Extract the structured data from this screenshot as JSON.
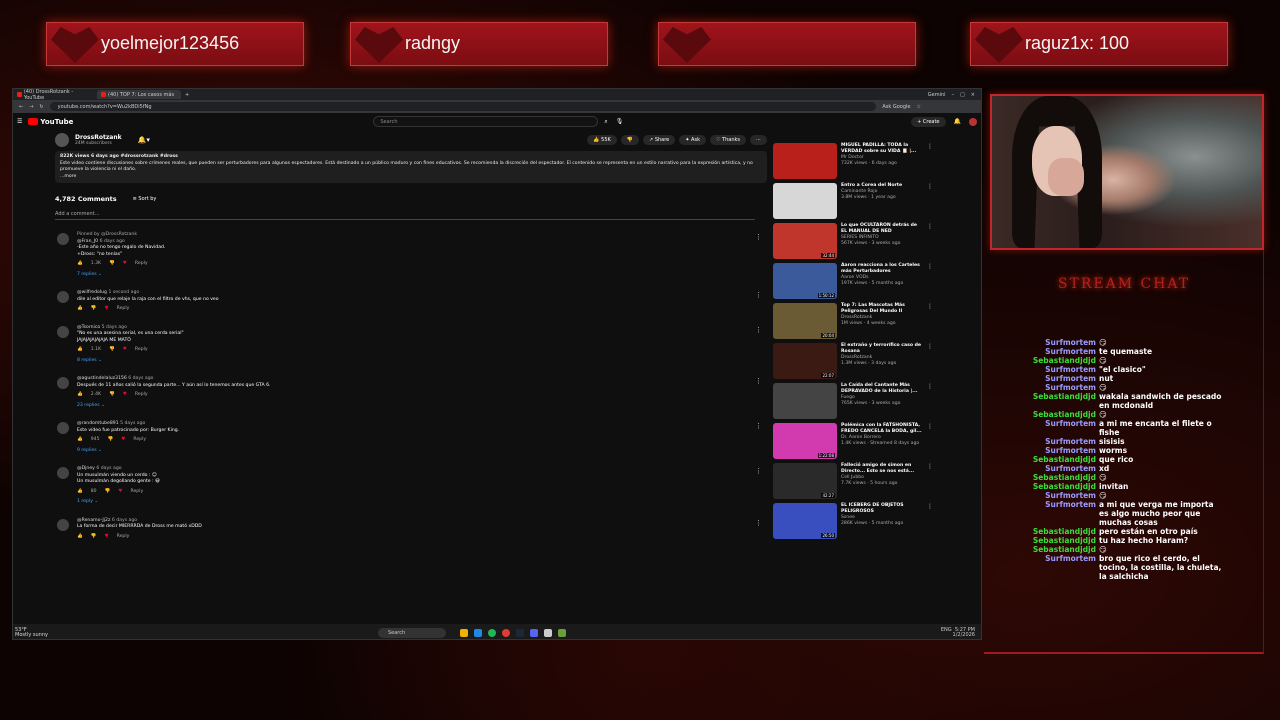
{
  "banners": [
    "yoelmejor123456",
    "radngy",
    "",
    "raguz1x: 100"
  ],
  "browser": {
    "tabs": [
      {
        "label": "(40) DrossRotzank - YouTube"
      },
      {
        "label": "(40) TOP 7: Los casos más"
      }
    ],
    "window_buttons": [
      "Gemini",
      "–",
      "□",
      "×"
    ],
    "url": "youtube.com/watch?v=Wu2kBDi5fNg",
    "ask_google": "Ask Google"
  },
  "youtube": {
    "logo": "YouTube",
    "search_placeholder": "Search",
    "create_label": "+ Create",
    "channel": {
      "name": "DrossRotzank",
      "subs": "24M subscribers"
    },
    "actions": [
      "👍 55K",
      "👎",
      "↗ Share",
      "✦ Ask",
      "♡ Thanks",
      "⋯"
    ],
    "description": {
      "meta": "822K views  6 days ago  #drossrotzank #dross",
      "text": "Este video contiene discusiones sobre crímenes reales, que pueden ser perturbadores para algunos espectadores. Está destinado a un público maduro y con fines educativos.  Se recomienda la discreción del espectador. El contenido se representa en un estilo narrativo para la expresión artística, y no promueve la violencia ni el daño.",
      "more": "...more"
    },
    "comments_count": "4,782 Comments",
    "sort_label": "Sort by",
    "add_comment": "Add a comment...",
    "comments": [
      {
        "pinned": "Pinned by @DrossRotzank",
        "author": "@Fran_J0",
        "time": "6 days ago",
        "lines": [
          "-Este año no tengo regalo de Navidad.",
          "+Dross: \"no tenías\""
        ],
        "likes": "1.3K",
        "replies": "7 replies"
      },
      {
        "pinned": "",
        "author": "@wilfredolug",
        "time": "1 second ago",
        "lines": [
          "dile al editor que relaje la raja con el filtro de vhs, que no veo"
        ],
        "likes": "",
        "replies": ""
      },
      {
        "pinned": "",
        "author": "@Tsornico",
        "time": "5 days ago",
        "lines": [
          "\"No es una asesina serial, es una cerda serial\"",
          "JAJAJAJAJAJAJA ME MATÓ"
        ],
        "likes": "1.1K",
        "replies": "8 replies"
      },
      {
        "pinned": "",
        "author": "@agustindelaluz3156",
        "time": "6 days ago",
        "lines": [
          "Después de 11 años salió la segunda parte... Y aún así lo tenemos antes que GTA 6."
        ],
        "likes": "2.4K",
        "replies": "23 replies"
      },
      {
        "pinned": "",
        "author": "@randomtube891",
        "time": "5 days ago",
        "lines": [
          "Este vídeo fue patrocinado por: Burger King."
        ],
        "likes": "945",
        "replies": "9 replies"
      },
      {
        "pinned": "",
        "author": "@Djney",
        "time": "6 days ago",
        "lines": [
          "Un musulmán viendo un cerdo : 😐",
          "Un musulmán degollando gente : 😀"
        ],
        "likes": "80",
        "replies": "1 reply"
      },
      {
        "pinned": "",
        "author": "@Renamo-Jj2z",
        "time": "6 days ago",
        "lines": [
          "La forma de decir MIERRRDA de Dross me mató xDDD"
        ],
        "likes": "",
        "replies": ""
      }
    ],
    "recommendations": [
      {
        "title": "MIGUEL PADILLA: TODA la VERDAD sobre su VIDA 📋 |...",
        "channel": "Mr Doctor",
        "meta": "732K views · 6 days ago",
        "dur": "",
        "color": "#b9201c"
      },
      {
        "title": "Entro a Corea del Norte",
        "channel": "Caminante Rojo",
        "meta": "3.8M views · 1 year ago",
        "dur": "",
        "color": "#d7d7d7"
      },
      {
        "title": "Lo que OCULTARON detrás de EL MANUAL DE NED",
        "channel": "SERIES INFINITO",
        "meta": "567K views · 3 weeks ago",
        "dur": "32:44",
        "color": "#c0352c"
      },
      {
        "title": "Aaron reacciona a los Carteles más Perturbadores",
        "channel": "Aaron VODs",
        "meta": "197K views · 5 months ago",
        "dur": "1:50:12",
        "color": "#3b5a9c"
      },
      {
        "title": "Top 7: Las Mascotas Más Peligrosas Del Mundo II",
        "channel": "DrossRotzank",
        "meta": "1M views · 4 weeks ago",
        "dur": "20:04",
        "color": "#6b5b35"
      },
      {
        "title": "El extraño y terrorífico caso de Rosana",
        "channel": "DrossRotzank",
        "meta": "1.3M views · 3 days ago",
        "dur": "22:07",
        "color": "#3b1a14"
      },
      {
        "title": "La Caída del Cantante Más DEPRAVADO de la Historia |...",
        "channel": "Fuego",
        "meta": "765K views · 3 weeks ago",
        "dur": "",
        "color": "#444"
      },
      {
        "title": "Polémica con la FATSHONISTA, FREDO CANCELA la BODA, gil...",
        "channel": "Dr. Aaron Borrero",
        "meta": "1.4K views · Streamed 8 days ago",
        "dur": "1:22:08",
        "color": "#d23bb0"
      },
      {
        "title": "Falleció amigo de simon en Directo... Esto se nos está...",
        "channel": "Cell Jubbo",
        "meta": "7.7K views · 5 hours ago",
        "dur": "42:27",
        "color": "#2a2a2a"
      },
      {
        "title": "EL ICEBERG DE OBJETOS PELIGROSOS",
        "channel": "Ssnee",
        "meta": "286K views · 5 months ago",
        "dur": "26:50",
        "color": "#3a4fbf"
      }
    ]
  },
  "taskbar": {
    "weather": "53°F\nMostly sunny",
    "search": "Search",
    "lang": "ENG",
    "time": "5:27 PM",
    "date": "1/2/2026"
  },
  "chat": {
    "title": "STREAM CHAT",
    "lines": [
      {
        "name": "Surfmortem",
        "msg": "😏",
        "color": "#9b9bff"
      },
      {
        "name": "Surfmortem",
        "msg": "te quemaste",
        "color": "#9b9bff"
      },
      {
        "name": "Sebastiandjdjd",
        "msg": "😏",
        "color": "#3ddc3d"
      },
      {
        "name": "Surfmortem",
        "msg": "\"el clasico\"",
        "color": "#9b9bff"
      },
      {
        "name": "Surfmortem",
        "msg": "nut",
        "color": "#9b9bff"
      },
      {
        "name": "Surfmortem",
        "msg": "😏",
        "color": "#9b9bff"
      },
      {
        "name": "Sebastiandjdjd",
        "msg": "wakala sandwich de pescado en mcdonald",
        "color": "#3ddc3d"
      },
      {
        "name": "Sebastiandjdjd",
        "msg": "😏",
        "color": "#3ddc3d"
      },
      {
        "name": "Surfmortem",
        "msg": "a mi me encanta el filete o fishe",
        "color": "#9b9bff"
      },
      {
        "name": "Surfmortem",
        "msg": "sisisis",
        "color": "#9b9bff"
      },
      {
        "name": "Surfmortem",
        "msg": "worms",
        "color": "#9b9bff"
      },
      {
        "name": "Sebastiandjdjd",
        "msg": "que rico",
        "color": "#3ddc3d"
      },
      {
        "name": "Surfmortem",
        "msg": "xd",
        "color": "#9b9bff"
      },
      {
        "name": "Sebastiandjdjd",
        "msg": "😏",
        "color": "#3ddc3d"
      },
      {
        "name": "Sebastiandjdjd",
        "msg": "invitan",
        "color": "#3ddc3d"
      },
      {
        "name": "Surfmortem",
        "msg": "😏",
        "color": "#9b9bff"
      },
      {
        "name": "Surfmortem",
        "msg": "a mi que verga me importa es algo mucho peor que muchas cosas",
        "color": "#9b9bff"
      },
      {
        "name": "Sebastiandjdjd",
        "msg": "pero están en otro país",
        "color": "#3ddc3d"
      },
      {
        "name": "Sebastiandjdjd",
        "msg": "tu haz hecho Haram?",
        "color": "#3ddc3d"
      },
      {
        "name": "Sebastiandjdjd",
        "msg": "😏",
        "color": "#3ddc3d"
      },
      {
        "name": "Surfmortem",
        "msg": "bro que rico el cerdo, el tocino, la costilla, la chuleta, la salchicha",
        "color": "#9b9bff"
      }
    ]
  }
}
